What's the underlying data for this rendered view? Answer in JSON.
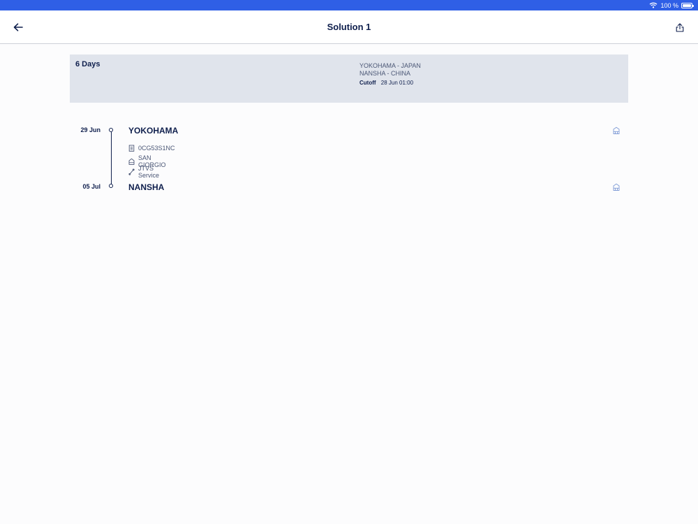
{
  "status_bar": {
    "battery_text": "100 %"
  },
  "nav": {
    "title": "Solution 1"
  },
  "summary": {
    "duration": "6 Days",
    "origin": "YOKOHAMA - JAPAN",
    "destination": "NANSHA - CHINA",
    "cutoff_label": "Cutoff",
    "cutoff_value": "28 Jun 01:00"
  },
  "route": {
    "departure": {
      "date": "29 Jun",
      "port": "YOKOHAMA"
    },
    "details": {
      "voyage": "0CG53S1NC",
      "vessel": "SAN GIORGIO",
      "service": "JTVS Service"
    },
    "arrival": {
      "date": "05 Jul",
      "port": "NANSHA"
    }
  },
  "colors": {
    "accent": "#2f5fe6",
    "text_primary": "#0f1f4d",
    "card_bg": "#e0e4ec",
    "icon_light": "#7f9bd6"
  }
}
